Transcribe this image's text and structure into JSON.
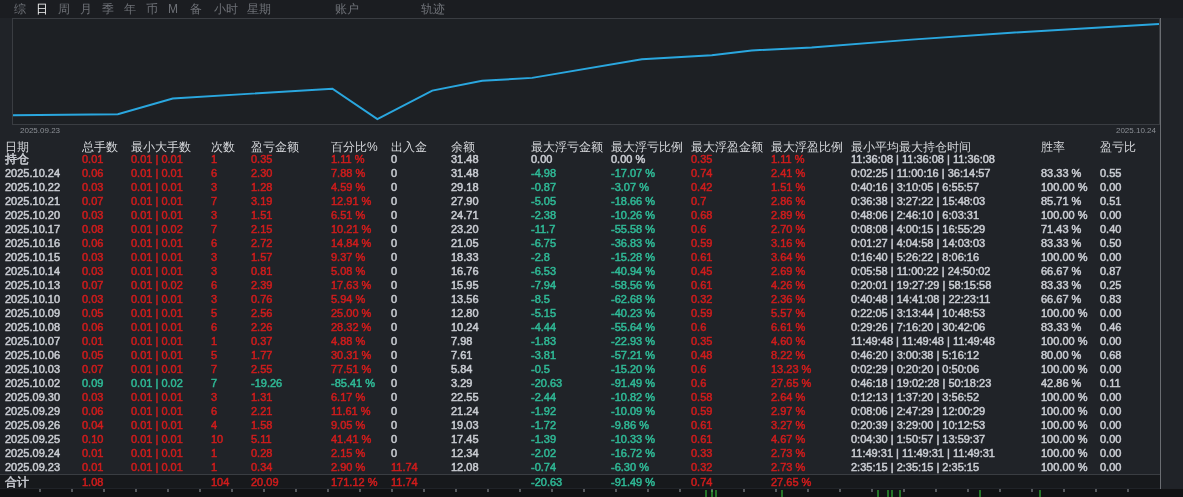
{
  "tabs": [
    {
      "label": "综",
      "selected": false
    },
    {
      "label": "日",
      "selected": true
    },
    {
      "label": "周",
      "selected": false
    },
    {
      "label": "月",
      "selected": false
    },
    {
      "label": "季",
      "selected": false
    },
    {
      "label": "年",
      "selected": false
    },
    {
      "label": "币",
      "selected": false
    },
    {
      "label": "M",
      "selected": false
    },
    {
      "label": "备",
      "selected": false
    },
    {
      "label": "小时",
      "selected": false
    },
    {
      "label": "星期",
      "selected": false
    },
    {
      "label": "账户",
      "selected": false
    },
    {
      "label": "轨迹",
      "selected": false
    }
  ],
  "chart": {
    "start_label": "2025.09.23",
    "end_label": "2025.10.24"
  },
  "table": {
    "columns": [
      "日期",
      "总手数",
      "最小大手数",
      "次数",
      "盈亏金额",
      "百分比%",
      "出入金",
      "余额",
      "最大浮亏金额",
      "最大浮亏比例",
      "最大浮盈金额",
      "最大浮盈比例",
      "最小平均最大持仓时间",
      "胜率",
      "盈亏比"
    ],
    "rows": [
      {
        "cells": [
          {
            "text": "持仓",
            "color": "#c9ccd2"
          },
          {
            "text": "0.01",
            "color": "#d01c1c"
          },
          {
            "text": "0.01 | 0.01",
            "color": "#d01c1c"
          },
          {
            "text": "1",
            "color": "#d01c1c"
          },
          {
            "text": "0.35",
            "color": "#d01c1c"
          },
          {
            "text": "1.11 %",
            "color": "#d01c1c"
          },
          {
            "text": "0",
            "color": "#c9ccd2"
          },
          {
            "text": "31.48",
            "color": "#c9ccd2"
          },
          {
            "text": "0.00",
            "color": "#c9ccd2"
          },
          {
            "text": "0.00 %",
            "color": "#c9ccd2"
          },
          {
            "text": "0.35",
            "color": "#d01c1c"
          },
          {
            "text": "1.11 %",
            "color": "#d01c1c"
          },
          {
            "text": "11:36:08 | 11:36:08 | 11:36:08",
            "color": "#c9ccd2"
          },
          null,
          null
        ]
      },
      {
        "cells": [
          {
            "text": "2025.10.24",
            "color": "#c9ccd2"
          },
          {
            "text": "0.06",
            "color": "#d01c1c"
          },
          {
            "text": "0.01 | 0.01",
            "color": "#d01c1c"
          },
          {
            "text": "6",
            "color": "#d01c1c"
          },
          {
            "text": "2.30",
            "color": "#d01c1c"
          },
          {
            "text": "7.88 %",
            "color": "#d01c1c"
          },
          {
            "text": "0",
            "color": "#c9ccd2"
          },
          {
            "text": "31.48",
            "color": "#c9ccd2"
          },
          {
            "text": "-4.98",
            "color": "#2fb996"
          },
          {
            "text": "-17.07 %",
            "color": "#2fb996"
          },
          {
            "text": "0.74",
            "color": "#d01c1c"
          },
          {
            "text": "2.41 %",
            "color": "#d01c1c"
          },
          {
            "text": "0:02:25 | 11:00:16 | 36:14:57",
            "color": "#c9ccd2"
          },
          {
            "text": "83.33 %",
            "color": "#c9ccd2"
          },
          {
            "text": "0.55",
            "color": "#c9ccd2"
          }
        ]
      },
      {
        "cells": [
          {
            "text": "2025.10.22",
            "color": "#c9ccd2"
          },
          {
            "text": "0.03",
            "color": "#d01c1c"
          },
          {
            "text": "0.01 | 0.01",
            "color": "#d01c1c"
          },
          {
            "text": "3",
            "color": "#d01c1c"
          },
          {
            "text": "1.28",
            "color": "#d01c1c"
          },
          {
            "text": "4.59 %",
            "color": "#d01c1c"
          },
          {
            "text": "0",
            "color": "#c9ccd2"
          },
          {
            "text": "29.18",
            "color": "#c9ccd2"
          },
          {
            "text": "-0.87",
            "color": "#2fb996"
          },
          {
            "text": "-3.07 %",
            "color": "#2fb996"
          },
          {
            "text": "0.42",
            "color": "#d01c1c"
          },
          {
            "text": "1.51 %",
            "color": "#d01c1c"
          },
          {
            "text": "0:40:16 | 3:10:05 | 6:55:57",
            "color": "#c9ccd2"
          },
          {
            "text": "100.00 %",
            "color": "#c9ccd2"
          },
          {
            "text": "0.00",
            "color": "#c9ccd2"
          }
        ]
      },
      {
        "cells": [
          {
            "text": "2025.10.21",
            "color": "#c9ccd2"
          },
          {
            "text": "0.07",
            "color": "#d01c1c"
          },
          {
            "text": "0.01 | 0.01",
            "color": "#d01c1c"
          },
          {
            "text": "7",
            "color": "#d01c1c"
          },
          {
            "text": "3.19",
            "color": "#d01c1c"
          },
          {
            "text": "12.91 %",
            "color": "#d01c1c"
          },
          {
            "text": "0",
            "color": "#c9ccd2"
          },
          {
            "text": "27.90",
            "color": "#c9ccd2"
          },
          {
            "text": "-5.05",
            "color": "#2fb996"
          },
          {
            "text": "-18.66 %",
            "color": "#2fb996"
          },
          {
            "text": "0.7",
            "color": "#d01c1c"
          },
          {
            "text": "2.86 %",
            "color": "#d01c1c"
          },
          {
            "text": "0:36:38 | 3:27:22 | 15:48:03",
            "color": "#c9ccd2"
          },
          {
            "text": "85.71 %",
            "color": "#c9ccd2"
          },
          {
            "text": "0.51",
            "color": "#c9ccd2"
          }
        ]
      },
      {
        "cells": [
          {
            "text": "2025.10.20",
            "color": "#c9ccd2"
          },
          {
            "text": "0.03",
            "color": "#d01c1c"
          },
          {
            "text": "0.01 | 0.01",
            "color": "#d01c1c"
          },
          {
            "text": "3",
            "color": "#d01c1c"
          },
          {
            "text": "1.51",
            "color": "#d01c1c"
          },
          {
            "text": "6.51 %",
            "color": "#d01c1c"
          },
          {
            "text": "0",
            "color": "#c9ccd2"
          },
          {
            "text": "24.71",
            "color": "#c9ccd2"
          },
          {
            "text": "-2.38",
            "color": "#2fb996"
          },
          {
            "text": "-10.26 %",
            "color": "#2fb996"
          },
          {
            "text": "0.68",
            "color": "#d01c1c"
          },
          {
            "text": "2.89 %",
            "color": "#d01c1c"
          },
          {
            "text": "0:48:06 | 2:46:10 | 6:03:31",
            "color": "#c9ccd2"
          },
          {
            "text": "100.00 %",
            "color": "#c9ccd2"
          },
          {
            "text": "0.00",
            "color": "#c9ccd2"
          }
        ]
      },
      {
        "cells": [
          {
            "text": "2025.10.17",
            "color": "#c9ccd2"
          },
          {
            "text": "0.08",
            "color": "#d01c1c"
          },
          {
            "text": "0.01 | 0.02",
            "color": "#d01c1c"
          },
          {
            "text": "7",
            "color": "#d01c1c"
          },
          {
            "text": "2.15",
            "color": "#d01c1c"
          },
          {
            "text": "10.21 %",
            "color": "#d01c1c"
          },
          {
            "text": "0",
            "color": "#c9ccd2"
          },
          {
            "text": "23.20",
            "color": "#c9ccd2"
          },
          {
            "text": "-11.7",
            "color": "#2fb996"
          },
          {
            "text": "-55.58 %",
            "color": "#2fb996"
          },
          {
            "text": "0.6",
            "color": "#d01c1c"
          },
          {
            "text": "2.70 %",
            "color": "#d01c1c"
          },
          {
            "text": "0:08:08 | 4:00:15 | 16:55:29",
            "color": "#c9ccd2"
          },
          {
            "text": "71.43 %",
            "color": "#c9ccd2"
          },
          {
            "text": "0.40",
            "color": "#c9ccd2"
          }
        ]
      },
      {
        "cells": [
          {
            "text": "2025.10.16",
            "color": "#c9ccd2"
          },
          {
            "text": "0.06",
            "color": "#d01c1c"
          },
          {
            "text": "0.01 | 0.01",
            "color": "#d01c1c"
          },
          {
            "text": "6",
            "color": "#d01c1c"
          },
          {
            "text": "2.72",
            "color": "#d01c1c"
          },
          {
            "text": "14.84 %",
            "color": "#d01c1c"
          },
          {
            "text": "0",
            "color": "#c9ccd2"
          },
          {
            "text": "21.05",
            "color": "#c9ccd2"
          },
          {
            "text": "-6.75",
            "color": "#2fb996"
          },
          {
            "text": "-36.83 %",
            "color": "#2fb996"
          },
          {
            "text": "0.59",
            "color": "#d01c1c"
          },
          {
            "text": "3.16 %",
            "color": "#d01c1c"
          },
          {
            "text": "0:01:27 | 4:04:58 | 14:03:03",
            "color": "#c9ccd2"
          },
          {
            "text": "83.33 %",
            "color": "#c9ccd2"
          },
          {
            "text": "0.50",
            "color": "#c9ccd2"
          }
        ]
      },
      {
        "cells": [
          {
            "text": "2025.10.15",
            "color": "#c9ccd2"
          },
          {
            "text": "0.03",
            "color": "#d01c1c"
          },
          {
            "text": "0.01 | 0.01",
            "color": "#d01c1c"
          },
          {
            "text": "3",
            "color": "#d01c1c"
          },
          {
            "text": "1.57",
            "color": "#d01c1c"
          },
          {
            "text": "9.37 %",
            "color": "#d01c1c"
          },
          {
            "text": "0",
            "color": "#c9ccd2"
          },
          {
            "text": "18.33",
            "color": "#c9ccd2"
          },
          {
            "text": "-2.8",
            "color": "#2fb996"
          },
          {
            "text": "-15.28 %",
            "color": "#2fb996"
          },
          {
            "text": "0.61",
            "color": "#d01c1c"
          },
          {
            "text": "3.64 %",
            "color": "#d01c1c"
          },
          {
            "text": "0:16:40 | 5:26:22 | 8:06:16",
            "color": "#c9ccd2"
          },
          {
            "text": "100.00 %",
            "color": "#c9ccd2"
          },
          {
            "text": "0.00",
            "color": "#c9ccd2"
          }
        ]
      },
      {
        "cells": [
          {
            "text": "2025.10.14",
            "color": "#c9ccd2"
          },
          {
            "text": "0.03",
            "color": "#d01c1c"
          },
          {
            "text": "0.01 | 0.01",
            "color": "#d01c1c"
          },
          {
            "text": "3",
            "color": "#d01c1c"
          },
          {
            "text": "0.81",
            "color": "#d01c1c"
          },
          {
            "text": "5.08 %",
            "color": "#d01c1c"
          },
          {
            "text": "0",
            "color": "#c9ccd2"
          },
          {
            "text": "16.76",
            "color": "#c9ccd2"
          },
          {
            "text": "-6.53",
            "color": "#2fb996"
          },
          {
            "text": "-40.94 %",
            "color": "#2fb996"
          },
          {
            "text": "0.45",
            "color": "#d01c1c"
          },
          {
            "text": "2.69 %",
            "color": "#d01c1c"
          },
          {
            "text": "0:05:58 | 11:00:22 | 24:50:02",
            "color": "#c9ccd2"
          },
          {
            "text": "66.67 %",
            "color": "#c9ccd2"
          },
          {
            "text": "0.87",
            "color": "#c9ccd2"
          }
        ]
      },
      {
        "cells": [
          {
            "text": "2025.10.13",
            "color": "#c9ccd2"
          },
          {
            "text": "0.07",
            "color": "#d01c1c"
          },
          {
            "text": "0.01 | 0.02",
            "color": "#d01c1c"
          },
          {
            "text": "6",
            "color": "#d01c1c"
          },
          {
            "text": "2.39",
            "color": "#d01c1c"
          },
          {
            "text": "17.63 %",
            "color": "#d01c1c"
          },
          {
            "text": "0",
            "color": "#c9ccd2"
          },
          {
            "text": "15.95",
            "color": "#c9ccd2"
          },
          {
            "text": "-7.94",
            "color": "#2fb996"
          },
          {
            "text": "-58.56 %",
            "color": "#2fb996"
          },
          {
            "text": "0.61",
            "color": "#d01c1c"
          },
          {
            "text": "4.26 %",
            "color": "#d01c1c"
          },
          {
            "text": "0:20:01 | 19:27:29 | 58:15:58",
            "color": "#c9ccd2"
          },
          {
            "text": "83.33 %",
            "color": "#c9ccd2"
          },
          {
            "text": "0.25",
            "color": "#c9ccd2"
          }
        ]
      },
      {
        "cells": [
          {
            "text": "2025.10.10",
            "color": "#c9ccd2"
          },
          {
            "text": "0.03",
            "color": "#d01c1c"
          },
          {
            "text": "0.01 | 0.01",
            "color": "#d01c1c"
          },
          {
            "text": "3",
            "color": "#d01c1c"
          },
          {
            "text": "0.76",
            "color": "#d01c1c"
          },
          {
            "text": "5.94 %",
            "color": "#d01c1c"
          },
          {
            "text": "0",
            "color": "#c9ccd2"
          },
          {
            "text": "13.56",
            "color": "#c9ccd2"
          },
          {
            "text": "-8.5",
            "color": "#2fb996"
          },
          {
            "text": "-62.68 %",
            "color": "#2fb996"
          },
          {
            "text": "0.32",
            "color": "#d01c1c"
          },
          {
            "text": "2.36 %",
            "color": "#d01c1c"
          },
          {
            "text": "0:40:48 | 14:41:08 | 22:23:11",
            "color": "#c9ccd2"
          },
          {
            "text": "66.67 %",
            "color": "#c9ccd2"
          },
          {
            "text": "0.83",
            "color": "#c9ccd2"
          }
        ]
      },
      {
        "cells": [
          {
            "text": "2025.10.09",
            "color": "#c9ccd2"
          },
          {
            "text": "0.05",
            "color": "#d01c1c"
          },
          {
            "text": "0.01 | 0.01",
            "color": "#d01c1c"
          },
          {
            "text": "5",
            "color": "#d01c1c"
          },
          {
            "text": "2.56",
            "color": "#d01c1c"
          },
          {
            "text": "25.00 %",
            "color": "#d01c1c"
          },
          {
            "text": "0",
            "color": "#c9ccd2"
          },
          {
            "text": "12.80",
            "color": "#c9ccd2"
          },
          {
            "text": "-5.15",
            "color": "#2fb996"
          },
          {
            "text": "-40.23 %",
            "color": "#2fb996"
          },
          {
            "text": "0.59",
            "color": "#d01c1c"
          },
          {
            "text": "5.57 %",
            "color": "#d01c1c"
          },
          {
            "text": "0:22:05 | 3:13:44 | 10:48:53",
            "color": "#c9ccd2"
          },
          {
            "text": "100.00 %",
            "color": "#c9ccd2"
          },
          {
            "text": "0.00",
            "color": "#c9ccd2"
          }
        ]
      },
      {
        "cells": [
          {
            "text": "2025.10.08",
            "color": "#c9ccd2"
          },
          {
            "text": "0.06",
            "color": "#d01c1c"
          },
          {
            "text": "0.01 | 0.01",
            "color": "#d01c1c"
          },
          {
            "text": "6",
            "color": "#d01c1c"
          },
          {
            "text": "2.26",
            "color": "#d01c1c"
          },
          {
            "text": "28.32 %",
            "color": "#d01c1c"
          },
          {
            "text": "0",
            "color": "#c9ccd2"
          },
          {
            "text": "10.24",
            "color": "#c9ccd2"
          },
          {
            "text": "-4.44",
            "color": "#2fb996"
          },
          {
            "text": "-55.64 %",
            "color": "#2fb996"
          },
          {
            "text": "0.6",
            "color": "#d01c1c"
          },
          {
            "text": "6.61 %",
            "color": "#d01c1c"
          },
          {
            "text": "0:29:26 | 7:16:20 | 30:42:06",
            "color": "#c9ccd2"
          },
          {
            "text": "83.33 %",
            "color": "#c9ccd2"
          },
          {
            "text": "0.46",
            "color": "#c9ccd2"
          }
        ]
      },
      {
        "cells": [
          {
            "text": "2025.10.07",
            "color": "#c9ccd2"
          },
          {
            "text": "0.01",
            "color": "#d01c1c"
          },
          {
            "text": "0.01 | 0.01",
            "color": "#d01c1c"
          },
          {
            "text": "1",
            "color": "#d01c1c"
          },
          {
            "text": "0.37",
            "color": "#d01c1c"
          },
          {
            "text": "4.88 %",
            "color": "#d01c1c"
          },
          {
            "text": "0",
            "color": "#c9ccd2"
          },
          {
            "text": "7.98",
            "color": "#c9ccd2"
          },
          {
            "text": "-1.83",
            "color": "#2fb996"
          },
          {
            "text": "-22.93 %",
            "color": "#2fb996"
          },
          {
            "text": "0.35",
            "color": "#d01c1c"
          },
          {
            "text": "4.60 %",
            "color": "#d01c1c"
          },
          {
            "text": "11:49:48 | 11:49:48 | 11:49:48",
            "color": "#c9ccd2"
          },
          {
            "text": "100.00 %",
            "color": "#c9ccd2"
          },
          {
            "text": "0.00",
            "color": "#c9ccd2"
          }
        ]
      },
      {
        "cells": [
          {
            "text": "2025.10.06",
            "color": "#c9ccd2"
          },
          {
            "text": "0.05",
            "color": "#d01c1c"
          },
          {
            "text": "0.01 | 0.01",
            "color": "#d01c1c"
          },
          {
            "text": "5",
            "color": "#d01c1c"
          },
          {
            "text": "1.77",
            "color": "#d01c1c"
          },
          {
            "text": "30.31 %",
            "color": "#d01c1c"
          },
          {
            "text": "0",
            "color": "#c9ccd2"
          },
          {
            "text": "7.61",
            "color": "#c9ccd2"
          },
          {
            "text": "-3.81",
            "color": "#2fb996"
          },
          {
            "text": "-57.21 %",
            "color": "#2fb996"
          },
          {
            "text": "0.48",
            "color": "#d01c1c"
          },
          {
            "text": "8.22 %",
            "color": "#d01c1c"
          },
          {
            "text": "0:46:20 | 3:00:38 | 5:16:12",
            "color": "#c9ccd2"
          },
          {
            "text": "80.00 %",
            "color": "#c9ccd2"
          },
          {
            "text": "0.68",
            "color": "#c9ccd2"
          }
        ]
      },
      {
        "cells": [
          {
            "text": "2025.10.03",
            "color": "#c9ccd2"
          },
          {
            "text": "0.07",
            "color": "#d01c1c"
          },
          {
            "text": "0.01 | 0.01",
            "color": "#d01c1c"
          },
          {
            "text": "7",
            "color": "#d01c1c"
          },
          {
            "text": "2.55",
            "color": "#d01c1c"
          },
          {
            "text": "77.51 %",
            "color": "#d01c1c"
          },
          {
            "text": "0",
            "color": "#c9ccd2"
          },
          {
            "text": "5.84",
            "color": "#c9ccd2"
          },
          {
            "text": "-0.5",
            "color": "#2fb996"
          },
          {
            "text": "-15.20 %",
            "color": "#2fb996"
          },
          {
            "text": "0.6",
            "color": "#d01c1c"
          },
          {
            "text": "13.23 %",
            "color": "#d01c1c"
          },
          {
            "text": "0:02:29 | 0:20:20 | 0:50:06",
            "color": "#c9ccd2"
          },
          {
            "text": "100.00 %",
            "color": "#c9ccd2"
          },
          {
            "text": "0.00",
            "color": "#c9ccd2"
          }
        ]
      },
      {
        "cells": [
          {
            "text": "2025.10.02",
            "color": "#c9ccd2"
          },
          {
            "text": "0.09",
            "color": "#2fb996"
          },
          {
            "text": "0.01 | 0.02",
            "color": "#2fb996"
          },
          {
            "text": "7",
            "color": "#2fb996"
          },
          {
            "text": "-19.26",
            "color": "#2fb996"
          },
          {
            "text": "-85.41 %",
            "color": "#2fb996"
          },
          {
            "text": "0",
            "color": "#c9ccd2"
          },
          {
            "text": "3.29",
            "color": "#c9ccd2"
          },
          {
            "text": "-20.63",
            "color": "#2fb996"
          },
          {
            "text": "-91.49 %",
            "color": "#2fb996"
          },
          {
            "text": "0.6",
            "color": "#d01c1c"
          },
          {
            "text": "27.65 %",
            "color": "#d01c1c"
          },
          {
            "text": "0:46:18 | 19:02:28 | 50:18:23",
            "color": "#c9ccd2"
          },
          {
            "text": "42.86 %",
            "color": "#c9ccd2"
          },
          {
            "text": "0.11",
            "color": "#c9ccd2"
          }
        ]
      },
      {
        "cells": [
          {
            "text": "2025.09.30",
            "color": "#c9ccd2"
          },
          {
            "text": "0.03",
            "color": "#d01c1c"
          },
          {
            "text": "0.01 | 0.01",
            "color": "#d01c1c"
          },
          {
            "text": "3",
            "color": "#d01c1c"
          },
          {
            "text": "1.31",
            "color": "#d01c1c"
          },
          {
            "text": "6.17 %",
            "color": "#d01c1c"
          },
          {
            "text": "0",
            "color": "#c9ccd2"
          },
          {
            "text": "22.55",
            "color": "#c9ccd2"
          },
          {
            "text": "-2.44",
            "color": "#2fb996"
          },
          {
            "text": "-10.82 %",
            "color": "#2fb996"
          },
          {
            "text": "0.58",
            "color": "#d01c1c"
          },
          {
            "text": "2.64 %",
            "color": "#d01c1c"
          },
          {
            "text": "0:12:13 | 1:37:20 | 3:56:52",
            "color": "#c9ccd2"
          },
          {
            "text": "100.00 %",
            "color": "#c9ccd2"
          },
          {
            "text": "0.00",
            "color": "#c9ccd2"
          }
        ]
      },
      {
        "cells": [
          {
            "text": "2025.09.29",
            "color": "#c9ccd2"
          },
          {
            "text": "0.06",
            "color": "#d01c1c"
          },
          {
            "text": "0.01 | 0.01",
            "color": "#d01c1c"
          },
          {
            "text": "6",
            "color": "#d01c1c"
          },
          {
            "text": "2.21",
            "color": "#d01c1c"
          },
          {
            "text": "11.61 %",
            "color": "#d01c1c"
          },
          {
            "text": "0",
            "color": "#c9ccd2"
          },
          {
            "text": "21.24",
            "color": "#c9ccd2"
          },
          {
            "text": "-1.92",
            "color": "#2fb996"
          },
          {
            "text": "-10.09 %",
            "color": "#2fb996"
          },
          {
            "text": "0.59",
            "color": "#d01c1c"
          },
          {
            "text": "2.97 %",
            "color": "#d01c1c"
          },
          {
            "text": "0:08:06 | 2:47:29 | 12:00:29",
            "color": "#c9ccd2"
          },
          {
            "text": "100.00 %",
            "color": "#c9ccd2"
          },
          {
            "text": "0.00",
            "color": "#c9ccd2"
          }
        ]
      },
      {
        "cells": [
          {
            "text": "2025.09.26",
            "color": "#c9ccd2"
          },
          {
            "text": "0.04",
            "color": "#d01c1c"
          },
          {
            "text": "0.01 | 0.01",
            "color": "#d01c1c"
          },
          {
            "text": "4",
            "color": "#d01c1c"
          },
          {
            "text": "1.58",
            "color": "#d01c1c"
          },
          {
            "text": "9.05 %",
            "color": "#d01c1c"
          },
          {
            "text": "0",
            "color": "#c9ccd2"
          },
          {
            "text": "19.03",
            "color": "#c9ccd2"
          },
          {
            "text": "-1.72",
            "color": "#2fb996"
          },
          {
            "text": "-9.86 %",
            "color": "#2fb996"
          },
          {
            "text": "0.61",
            "color": "#d01c1c"
          },
          {
            "text": "3.27 %",
            "color": "#d01c1c"
          },
          {
            "text": "0:20:39 | 3:29:00 | 10:12:53",
            "color": "#c9ccd2"
          },
          {
            "text": "100.00 %",
            "color": "#c9ccd2"
          },
          {
            "text": "0.00",
            "color": "#c9ccd2"
          }
        ]
      },
      {
        "cells": [
          {
            "text": "2025.09.25",
            "color": "#c9ccd2"
          },
          {
            "text": "0.10",
            "color": "#d01c1c"
          },
          {
            "text": "0.01 | 0.01",
            "color": "#d01c1c"
          },
          {
            "text": "10",
            "color": "#d01c1c"
          },
          {
            "text": "5.11",
            "color": "#d01c1c"
          },
          {
            "text": "41.41 %",
            "color": "#d01c1c"
          },
          {
            "text": "0",
            "color": "#c9ccd2"
          },
          {
            "text": "17.45",
            "color": "#c9ccd2"
          },
          {
            "text": "-1.39",
            "color": "#2fb996"
          },
          {
            "text": "-10.33 %",
            "color": "#2fb996"
          },
          {
            "text": "0.61",
            "color": "#d01c1c"
          },
          {
            "text": "4.67 %",
            "color": "#d01c1c"
          },
          {
            "text": "0:04:30 | 1:50:57 | 13:59:37",
            "color": "#c9ccd2"
          },
          {
            "text": "100.00 %",
            "color": "#c9ccd2"
          },
          {
            "text": "0.00",
            "color": "#c9ccd2"
          }
        ]
      },
      {
        "cells": [
          {
            "text": "2025.09.24",
            "color": "#c9ccd2"
          },
          {
            "text": "0.01",
            "color": "#d01c1c"
          },
          {
            "text": "0.01 | 0.01",
            "color": "#d01c1c"
          },
          {
            "text": "1",
            "color": "#d01c1c"
          },
          {
            "text": "0.28",
            "color": "#d01c1c"
          },
          {
            "text": "2.15 %",
            "color": "#d01c1c"
          },
          {
            "text": "0",
            "color": "#c9ccd2"
          },
          {
            "text": "12.34",
            "color": "#c9ccd2"
          },
          {
            "text": "-2.02",
            "color": "#2fb996"
          },
          {
            "text": "-16.72 %",
            "color": "#2fb996"
          },
          {
            "text": "0.33",
            "color": "#d01c1c"
          },
          {
            "text": "2.73 %",
            "color": "#d01c1c"
          },
          {
            "text": "11:49:31 | 11:49:31 | 11:49:31",
            "color": "#c9ccd2"
          },
          {
            "text": "100.00 %",
            "color": "#c9ccd2"
          },
          {
            "text": "0.00",
            "color": "#c9ccd2"
          }
        ]
      },
      {
        "cells": [
          {
            "text": "2025.09.23",
            "color": "#c9ccd2"
          },
          {
            "text": "0.01",
            "color": "#d01c1c"
          },
          {
            "text": "0.01 | 0.01",
            "color": "#d01c1c"
          },
          {
            "text": "1",
            "color": "#d01c1c"
          },
          {
            "text": "0.34",
            "color": "#d01c1c"
          },
          {
            "text": "2.90 %",
            "color": "#d01c1c"
          },
          {
            "text": "11.74",
            "color": "#d01c1c"
          },
          {
            "text": "12.08",
            "color": "#c9ccd2"
          },
          {
            "text": "-0.74",
            "color": "#2fb996"
          },
          {
            "text": "-6.30 %",
            "color": "#2fb996"
          },
          {
            "text": "0.32",
            "color": "#d01c1c"
          },
          {
            "text": "2.73 %",
            "color": "#d01c1c"
          },
          {
            "text": "2:35:15 | 2:35:15 | 2:35:15",
            "color": "#c9ccd2"
          },
          {
            "text": "100.00 %",
            "color": "#c9ccd2"
          },
          {
            "text": "0.00",
            "color": "#c9ccd2"
          }
        ]
      }
    ],
    "total": {
      "cells": [
        {
          "text": "合计",
          "color": "#c9ccd2"
        },
        {
          "text": "1.08",
          "color": "#d01c1c"
        },
        null,
        {
          "text": "104",
          "color": "#d01c1c"
        },
        {
          "text": "20.09",
          "color": "#d01c1c"
        },
        {
          "text": "171.12 %",
          "color": "#d01c1c"
        },
        {
          "text": "11.74",
          "color": "#d01c1c"
        },
        null,
        {
          "text": "-20.63",
          "color": "#2fb996"
        },
        {
          "text": "-91.49 %",
          "color": "#2fb996"
        },
        {
          "text": "0.74",
          "color": "#d01c1c"
        },
        {
          "text": "27.65 %",
          "color": "#d01c1c"
        },
        null,
        null,
        null
      ]
    }
  }
}
